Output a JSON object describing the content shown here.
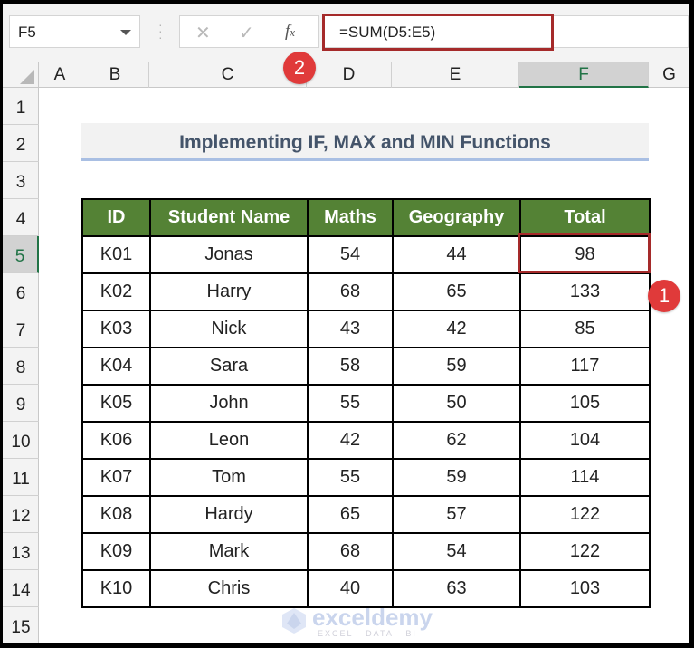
{
  "formula_bar": {
    "name_box": "F5",
    "formula": "=SUM(D5:E5)",
    "icons": [
      "cancel-icon",
      "enter-icon",
      "fx-icon"
    ],
    "cancel_glyph": "✕",
    "enter_glyph": "✓",
    "fx_glyph": "fx"
  },
  "columns": [
    "A",
    "B",
    "C",
    "D",
    "E",
    "F",
    "G"
  ],
  "selected_column": "F",
  "rows": [
    "1",
    "2",
    "3",
    "4",
    "5",
    "6",
    "7",
    "8",
    "9",
    "10",
    "11",
    "12",
    "13",
    "14",
    "15"
  ],
  "selected_row": "5",
  "title": "Implementing IF, MAX and MIN Functions",
  "table": {
    "headers": [
      "ID",
      "Student Name",
      "Maths",
      "Geography",
      "Total"
    ],
    "rows": [
      [
        "K01",
        "Jonas",
        "54",
        "44",
        "98"
      ],
      [
        "K02",
        "Harry",
        "68",
        "65",
        "133"
      ],
      [
        "K03",
        "Nick",
        "43",
        "42",
        "85"
      ],
      [
        "K04",
        "Sara",
        "58",
        "59",
        "117"
      ],
      [
        "K05",
        "John",
        "55",
        "50",
        "105"
      ],
      [
        "K06",
        "Leon",
        "42",
        "62",
        "104"
      ],
      [
        "K07",
        "Tom",
        "55",
        "59",
        "114"
      ],
      [
        "K08",
        "Hardy",
        "65",
        "57",
        "122"
      ],
      [
        "K09",
        "Mark",
        "68",
        "54",
        "122"
      ],
      [
        "K10",
        "Chris",
        "40",
        "63",
        "103"
      ]
    ]
  },
  "annotations": {
    "badge_1": "1",
    "badge_2": "2",
    "highlight_color": "#a52a2a",
    "badge_color": "#e03a3a"
  },
  "colors": {
    "header_green": "#548235",
    "title_text": "#44546a",
    "title_underline": "#a9bfe3",
    "selection_green": "#217346"
  },
  "watermark": {
    "name": "exceldemy",
    "tagline": "EXCEL · DATA · BI"
  }
}
